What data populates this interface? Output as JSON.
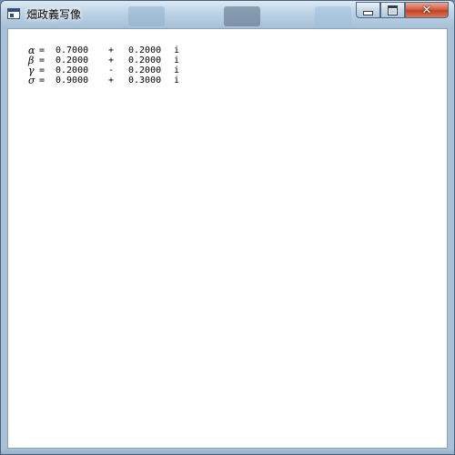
{
  "window": {
    "title": "畑政義写像",
    "close_glyph": "✕"
  },
  "parameters": [
    {
      "symbol": "α",
      "eq": "=",
      "re": "0.7000",
      "op": "+",
      "im": "0.2000",
      "unit": "i"
    },
    {
      "symbol": "β",
      "eq": "=",
      "re": "0.2000",
      "op": "+",
      "im": "0.2000",
      "unit": "i"
    },
    {
      "symbol": "γ",
      "eq": "=",
      "re": "0.2000",
      "op": "-",
      "im": "0.2000",
      "unit": "i"
    },
    {
      "symbol": "σ",
      "eq": "=",
      "re": "0.9000",
      "op": "+",
      "im": "0.3000",
      "unit": "i"
    }
  ],
  "colors": {
    "fractal": "#2a7a2a",
    "background": "#ffffff",
    "close_button": "#c5401f"
  },
  "icons": {
    "app": "application-window-icon",
    "minimize": "minimize-icon",
    "maximize": "maximize-icon",
    "close": "close-icon"
  }
}
